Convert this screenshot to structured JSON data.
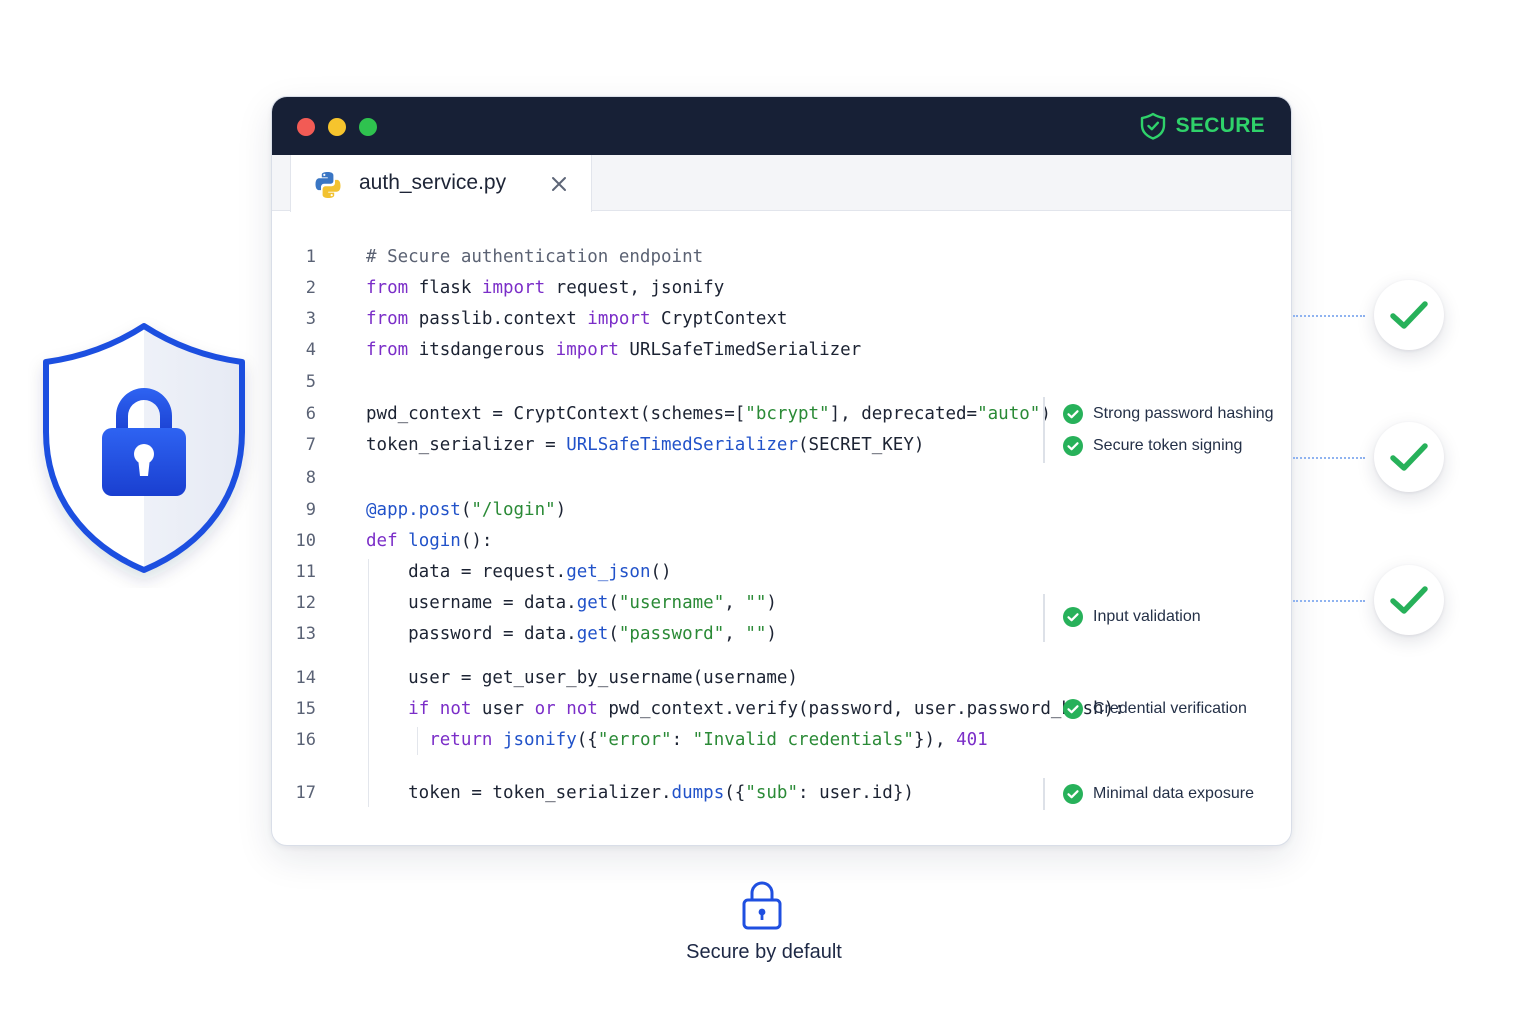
{
  "window": {
    "status_label": "SECURE",
    "tab": {
      "filename": "auth_service.py",
      "icon": "python-icon",
      "close_icon": "close-icon"
    }
  },
  "code_lines": [
    {
      "n": "1",
      "tokens": [
        [
          "cm",
          "# Secure authentication endpoint"
        ]
      ]
    },
    {
      "n": "2",
      "tokens": [
        [
          "kw",
          "from"
        ],
        [
          "",
          " flask "
        ],
        [
          "kw",
          "import"
        ],
        [
          "",
          " request, jsonify"
        ]
      ]
    },
    {
      "n": "3",
      "tokens": [
        [
          "kw",
          "from"
        ],
        [
          "",
          " passlib.context "
        ],
        [
          "kw",
          "import"
        ],
        [
          "",
          " CryptContext"
        ]
      ]
    },
    {
      "n": "4",
      "tokens": [
        [
          "kw",
          "from"
        ],
        [
          "",
          " itsdangerous "
        ],
        [
          "kw",
          "import"
        ],
        [
          "",
          " URLSafeTimedSerializer"
        ]
      ]
    },
    {
      "n": "5",
      "tokens": []
    },
    {
      "n": "6",
      "tokens": [
        [
          "",
          "pwd_context = CryptContext(schemes=["
        ],
        [
          "st",
          "\"bcrypt\""
        ],
        [
          "",
          "], deprecated="
        ],
        [
          "st",
          "\"auto\""
        ],
        [
          "",
          ")"
        ]
      ]
    },
    {
      "n": "7",
      "tokens": [
        [
          "",
          "token_serializer = "
        ],
        [
          "fn",
          "URLSafeTimedSerializer"
        ],
        [
          "",
          "(SECRET_KEY)"
        ]
      ]
    },
    {
      "n": "8",
      "tokens": []
    },
    {
      "n": "9",
      "tokens": [
        [
          "fn",
          "@app.post"
        ],
        [
          "",
          "("
        ],
        [
          "st",
          "\"/login\""
        ],
        [
          "",
          ")"
        ]
      ]
    },
    {
      "n": "10",
      "tokens": [
        [
          "kw",
          "def"
        ],
        [
          "",
          " "
        ],
        [
          "fn",
          "login"
        ],
        [
          "",
          "():"
        ]
      ]
    },
    {
      "n": "11",
      "tokens": [
        [
          "",
          "    data = request."
        ],
        [
          "fn",
          "get_json"
        ],
        [
          "",
          "()"
        ]
      ]
    },
    {
      "n": "12",
      "tokens": [
        [
          "",
          "    username = data."
        ],
        [
          "fn",
          "get"
        ],
        [
          "",
          "("
        ],
        [
          "st",
          "\"username\""
        ],
        [
          "",
          ", "
        ],
        [
          "st",
          "\"\""
        ],
        [
          "",
          ")"
        ]
      ]
    },
    {
      "n": "13",
      "tokens": [
        [
          "",
          "    password = data."
        ],
        [
          "fn",
          "get"
        ],
        [
          "",
          "("
        ],
        [
          "st",
          "\"password\""
        ],
        [
          "",
          ", "
        ],
        [
          "st",
          "\"\""
        ],
        [
          "",
          ")"
        ]
      ]
    },
    {
      "n": "14",
      "tokens": [
        [
          "",
          "    user = get_user_by_username(username)"
        ]
      ]
    },
    {
      "n": "15",
      "tokens": [
        [
          "",
          "    "
        ],
        [
          "kw",
          "if"
        ],
        [
          "",
          " "
        ],
        [
          "kw",
          "not"
        ],
        [
          "",
          " user "
        ],
        [
          "kw",
          "or"
        ],
        [
          "",
          " "
        ],
        [
          "kw",
          "not"
        ],
        [
          "",
          " pwd_context.verify(password, user.password_hash):"
        ]
      ]
    },
    {
      "n": "16",
      "tokens": [
        [
          "",
          "      "
        ],
        [
          "kw",
          "return"
        ],
        [
          "",
          " "
        ],
        [
          "fn",
          "jsonify"
        ],
        [
          "",
          "({"
        ],
        [
          "st",
          "\"error\""
        ],
        [
          "",
          ": "
        ],
        [
          "st",
          "\"Invalid credentials\""
        ],
        [
          "",
          "}), "
        ],
        [
          "nu",
          "401"
        ]
      ]
    },
    {
      "n": "17",
      "tokens": [
        [
          "",
          "    token = token_serializer."
        ],
        [
          "fn",
          "dumps"
        ],
        [
          "",
          "({"
        ],
        [
          "st",
          "\"sub\""
        ],
        [
          "",
          ": user.id})"
        ]
      ]
    }
  ],
  "annotations": [
    {
      "label": "Strong password hashing"
    },
    {
      "label": "Secure token signing"
    },
    {
      "label": "Input validation"
    },
    {
      "label": "Credential verification"
    },
    {
      "label": "Minimal data exposure"
    }
  ],
  "side_checks": [
    "check-icon",
    "check-icon",
    "check-icon"
  ],
  "footer": {
    "label": "Secure by default",
    "icon": "lock-icon"
  },
  "colors": {
    "titlebar": "#172036",
    "secure_green": "#2fd26a",
    "check_green": "#27b15a",
    "shield_blue": "#1f4fe0",
    "keyword": "#7b2ec8",
    "function": "#2152c9",
    "string": "#2a8a36"
  }
}
